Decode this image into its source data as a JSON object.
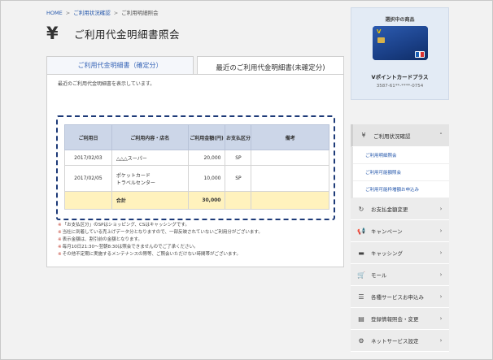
{
  "breadcrumb": [
    "HOME",
    "ご利用状況確認",
    "ご利用明細照会"
  ],
  "breadcrumb_sep": ">",
  "title_icon": "yen-icon",
  "page_title": "ご利用代金明細書照会",
  "tabs": {
    "confirmed": "ご利用代金明細書（確定分）",
    "unconfirmed": "最近のご利用代金明細書(未確定分)"
  },
  "intro": "最近のご利用代金明細書を表示しています。",
  "table": {
    "headers": [
      "ご利用日",
      "ご利用内容・店名",
      "ご利用金額(円)",
      "お支払区分",
      "備考"
    ],
    "rows": [
      {
        "date": "2017/02/03",
        "store": "△△△スーパー",
        "store2": "",
        "amount": "20,000",
        "payment": "SP",
        "note": ""
      },
      {
        "date": "2017/02/05",
        "store": "ポケットカード",
        "store2": "トラベルセンター",
        "amount": "10,000",
        "payment": "SP",
        "note": ""
      }
    ],
    "total_label": "合計",
    "total_amount": "30,000"
  },
  "notes": [
    "「お支払区分」のSPはショッピング、CSはキャッシングです。",
    "当社に到着している売上げデータ分となりますので、一部反映されていないご利用分がございます。",
    "表示金額は、割引前の金額となります。",
    "毎月10日21:30～翌朝8:30は照会できませんのでご了承ください。",
    "その他不定期に実施するメンテナンスの際等、ご照会いただけない時間帯がございます。"
  ],
  "note_mark": "※",
  "sidebar": {
    "card_heading": "選択中の商品",
    "card_logo": "V",
    "card_name": "Vポイントカードプラス",
    "card_number": "3587-61**-****-0754",
    "menu": [
      {
        "icon": "yen-icon",
        "glyph": "¥",
        "label": "ご利用状況確認",
        "chevron": "˄",
        "active": true
      },
      {
        "icon": "refresh-icon",
        "glyph": "↻",
        "label": "お支払金額変更",
        "chevron": "›"
      },
      {
        "icon": "megaphone-icon",
        "glyph": "📢",
        "label": "キャンペーン",
        "chevron": "›"
      },
      {
        "icon": "card-icon",
        "glyph": "▬",
        "label": "キャッシング",
        "chevron": "›"
      },
      {
        "icon": "cart-icon",
        "glyph": "🛒",
        "label": "モール",
        "chevron": "›"
      },
      {
        "icon": "list-icon",
        "glyph": "☰",
        "label": "各種サービスお申込み",
        "chevron": "›"
      },
      {
        "icon": "document-icon",
        "glyph": "▤",
        "label": "登録情報照会・変更",
        "chevron": "›"
      },
      {
        "icon": "gear-icon",
        "glyph": "⚙",
        "label": "ネットサービス設定",
        "chevron": "›"
      }
    ],
    "submenu": [
      "ご利用明細照会",
      "ご利用可能額照会",
      "ご利用可能枠増額お申込み"
    ]
  }
}
